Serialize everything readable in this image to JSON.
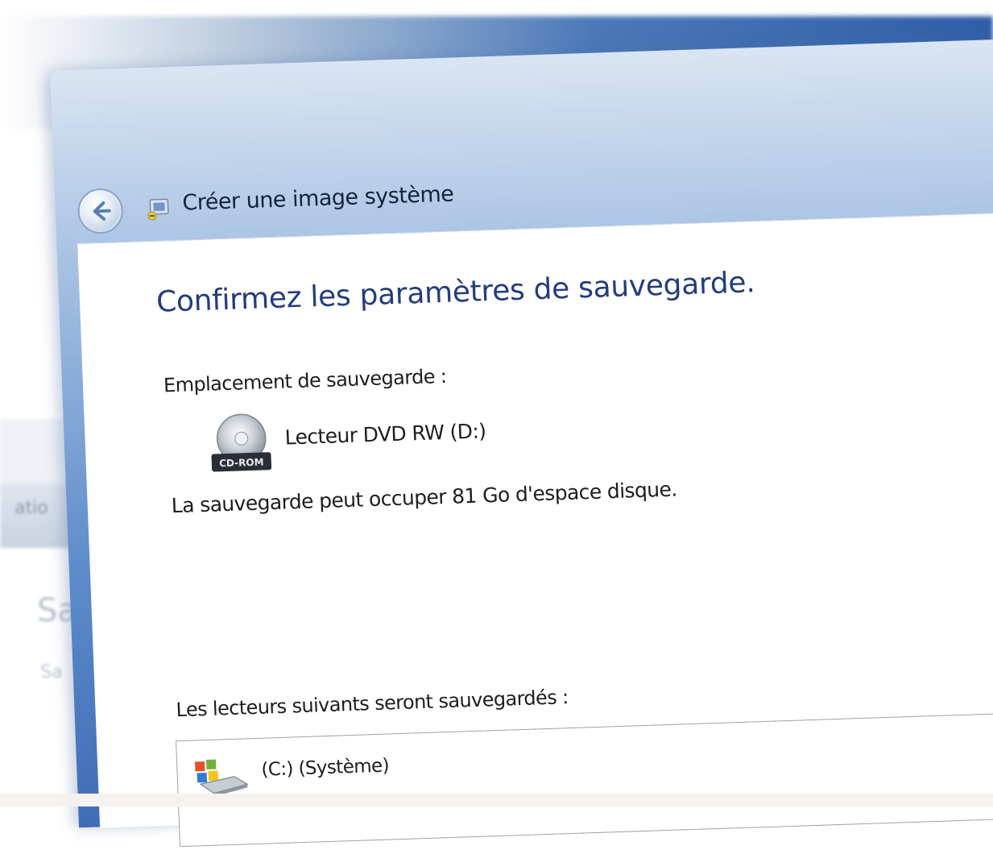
{
  "window": {
    "title": "Créer une image système",
    "heading": "Confirmez les paramètres de sauvegarde."
  },
  "backup_location": {
    "label": "Emplacement de sauvegarde :",
    "drive_name": "Lecteur DVD RW (D:)",
    "drive_icon_badge": "CD-ROM",
    "space_text": "La sauvegarde peut occuper 81 Go d'espace disque."
  },
  "drives": {
    "label": "Les lecteurs suivants seront sauvegardés :",
    "items": [
      {
        "name": "(C:) (Système)",
        "icon": "system-drive-icon"
      }
    ]
  },
  "background_window": {
    "fragments": [
      "atio",
      "Sa",
      "Sa"
    ]
  },
  "icons": {
    "back": "back-arrow-icon",
    "title": "image-backup-icon",
    "location": "cd-rom-drive-icon",
    "system_drive": "system-drive-icon"
  },
  "colors": {
    "heading": "#243d7a",
    "titlebar_dark": "#3e6db6",
    "titlebar_light": "#d9e5f3"
  }
}
